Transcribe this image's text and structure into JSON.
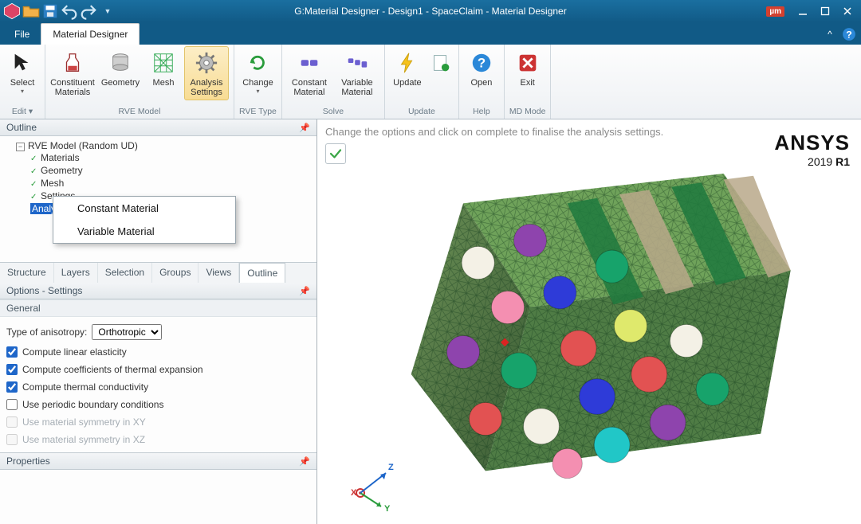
{
  "titlebar": {
    "title": "G:Material Designer - Design1 - SpaceClaim - Material Designer",
    "unit_badge": "µm"
  },
  "menu": {
    "file": "File",
    "active_tab": "Material Designer"
  },
  "ribbon": {
    "groups": {
      "edit": {
        "select": "Select",
        "label": "Edit"
      },
      "rve_model": {
        "constituent": "Constituent Materials",
        "geometry": "Geometry",
        "mesh": "Mesh",
        "settings": "Analysis Settings",
        "label": "RVE Model"
      },
      "rve_type": {
        "change": "Change",
        "label": "RVE Type"
      },
      "solve": {
        "constant": "Constant Material",
        "variable": "Variable Material",
        "label": "Solve"
      },
      "update": {
        "update": "Update",
        "label": "Update"
      },
      "help": {
        "open": "Open",
        "label": "Help"
      },
      "md_mode": {
        "exit": "Exit",
        "label": "MD Mode"
      }
    }
  },
  "outline": {
    "header": "Outline",
    "root": "RVE Model (Random UD)",
    "items": [
      "Materials",
      "Geometry",
      "Mesh",
      "Settings"
    ],
    "selected": "Analy",
    "context_menu": [
      "Constant Material",
      "Variable Material"
    ],
    "tabs": [
      "Structure",
      "Layers",
      "Selection",
      "Groups",
      "Views",
      "Outline"
    ],
    "active_tab": "Outline"
  },
  "options": {
    "header": "Options - Settings",
    "section": "General",
    "anisotropy_label": "Type of anisotropy:",
    "anisotropy_value": "Orthotropic",
    "rows": [
      {
        "label": "Compute linear elasticity",
        "checked": true,
        "disabled": false
      },
      {
        "label": "Compute coefficients of thermal expansion",
        "checked": true,
        "disabled": false
      },
      {
        "label": "Compute thermal conductivity",
        "checked": true,
        "disabled": false
      },
      {
        "label": "Use periodic boundary conditions",
        "checked": false,
        "disabled": false
      },
      {
        "label": "Use material symmetry in XY",
        "checked": false,
        "disabled": true
      },
      {
        "label": "Use material symmetry in XZ",
        "checked": false,
        "disabled": true
      }
    ]
  },
  "properties": {
    "header": "Properties"
  },
  "viewport": {
    "hint": "Change the options and click on complete to finalise the analysis settings.",
    "brand": "ANSYS",
    "brand_sub_year": "2019",
    "brand_sub_rel": "R1",
    "axes": {
      "x": "X",
      "y": "Y",
      "z": "Z"
    }
  }
}
